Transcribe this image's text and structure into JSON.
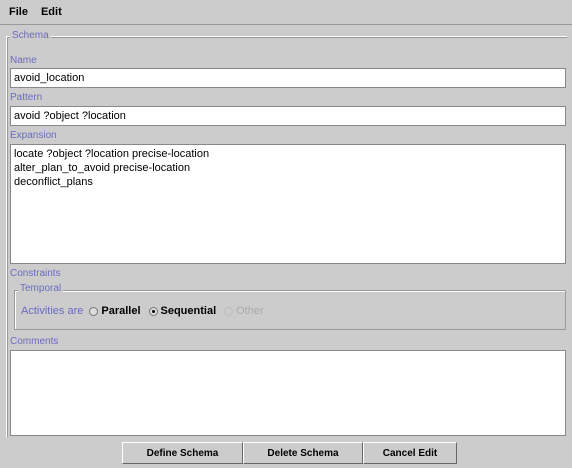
{
  "menu": {
    "file": "File",
    "edit": "Edit"
  },
  "schema": {
    "legend": "Schema",
    "name": {
      "label": "Name",
      "value": "avoid_location"
    },
    "pattern": {
      "label": "Pattern",
      "value": "avoid ?object ?location"
    },
    "expansion": {
      "label": "Expansion",
      "lines": [
        "locate ?object ?location precise-location",
        "alter_plan_to_avoid precise-location",
        "deconflict_plans"
      ]
    },
    "constraints": {
      "label": "Constraints",
      "temporal": {
        "legend": "Temporal",
        "prompt": "Activities are",
        "options": [
          {
            "label": "Parallel",
            "selected": false,
            "enabled": true
          },
          {
            "label": "Sequential",
            "selected": true,
            "enabled": true
          },
          {
            "label": "Other",
            "selected": false,
            "enabled": false
          }
        ]
      }
    },
    "comments": {
      "label": "Comments",
      "value": ""
    }
  },
  "buttons": {
    "define": "Define Schema",
    "delete": "Delete Schema",
    "cancel": "Cancel Edit"
  },
  "colors": {
    "label": "#6b6bbf",
    "background": "#cccccc"
  }
}
